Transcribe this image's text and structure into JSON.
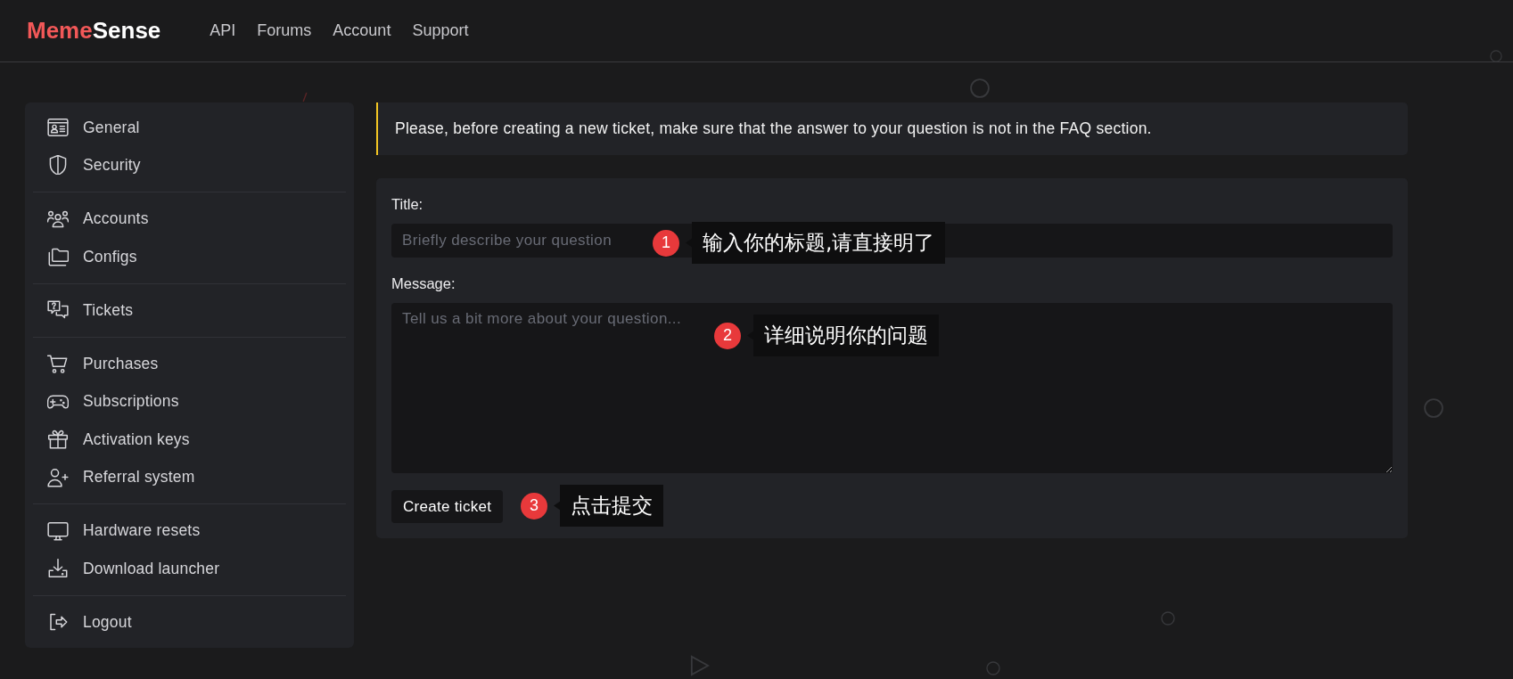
{
  "header": {
    "logo": {
      "accent": "Meme",
      "rest": "Sense"
    },
    "nav": [
      "API",
      "Forums",
      "Account",
      "Support"
    ]
  },
  "sidebar": {
    "groups": [
      {
        "items": [
          "General",
          "Security"
        ]
      },
      {
        "items": [
          "Accounts",
          "Configs"
        ]
      },
      {
        "items": [
          "Tickets"
        ]
      },
      {
        "items": [
          "Purchases",
          "Subscriptions",
          "Activation keys",
          "Referral system"
        ]
      },
      {
        "items": [
          "Hardware resets",
          "Download launcher"
        ]
      },
      {
        "items": [
          "Logout"
        ]
      }
    ]
  },
  "notice": {
    "text": "Please, before creating a new ticket, make sure that the answer to your question is not in the FAQ section."
  },
  "form": {
    "fields": [
      {
        "kind": "input",
        "label": "Title:",
        "placeholder": "Briefly describe your question"
      },
      {
        "kind": "textarea",
        "label": "Message:",
        "placeholder": "Tell us a bit more about your question..."
      }
    ],
    "submit": "Create ticket"
  },
  "annotations": [
    {
      "number": "1",
      "text": "输入你的标题,请直接明了"
    },
    {
      "number": "2",
      "text": "详细说明你的问题"
    },
    {
      "number": "3",
      "text": "点击提交"
    }
  ]
}
